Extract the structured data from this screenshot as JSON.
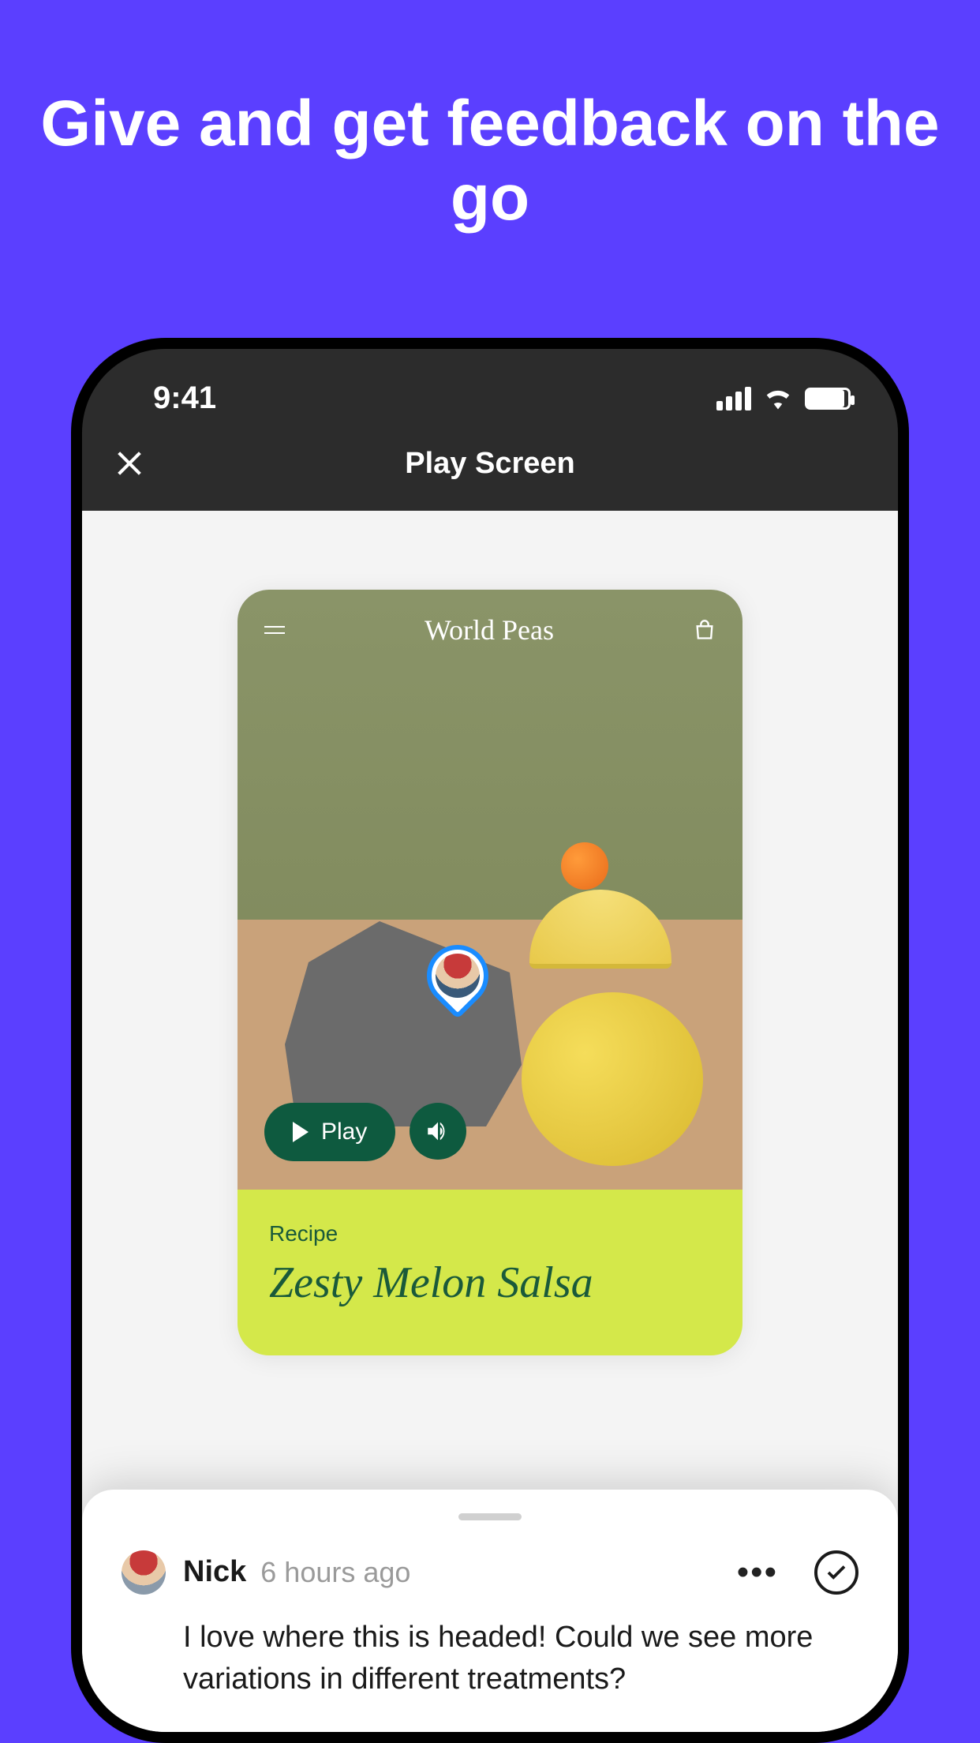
{
  "promo": {
    "headline": "Give and get feedback on the go"
  },
  "statusbar": {
    "time": "9:41"
  },
  "navbar": {
    "title": "Play Screen"
  },
  "mockup": {
    "brand": "World Peas",
    "play_label": "Play",
    "recipe_label": "Recipe",
    "recipe_title": "Zesty Melon Salsa"
  },
  "comment": {
    "author": "Nick",
    "timestamp": "6 hours ago",
    "body": "I love where this is headed! Could we see more variations in different treatments?"
  }
}
